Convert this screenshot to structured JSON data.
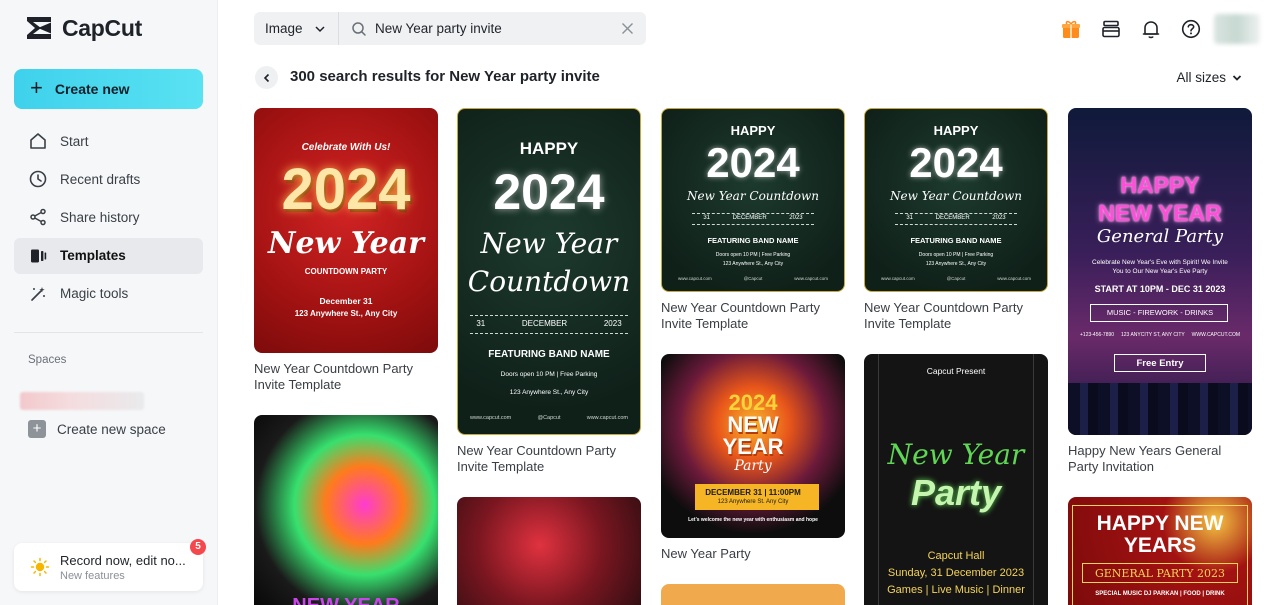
{
  "app": {
    "name": "CapCut",
    "create_label": "Create new",
    "nav": [
      {
        "label": "Start",
        "icon": "home-icon"
      },
      {
        "label": "Recent drafts",
        "icon": "clock-icon"
      },
      {
        "label": "Share history",
        "icon": "share-icon"
      },
      {
        "label": "Templates",
        "icon": "templates-icon",
        "active": true
      },
      {
        "label": "Magic tools",
        "icon": "magic-wand-icon"
      }
    ],
    "spaces_label": "Spaces",
    "create_space_label": "Create new space",
    "record": {
      "title": "Record now, edit no...",
      "subtitle": "New features",
      "badge": "5"
    }
  },
  "search": {
    "type": "Image",
    "query": "New Year party invite"
  },
  "results": {
    "title": "300 search results for New Year party invite",
    "filter": "All sizes"
  },
  "cards": [
    {
      "title": "New Year Countdown Party Invite Template",
      "bg": "#b01717",
      "lines": {
        "l1": "Celebrate With Us!",
        "year": "2024",
        "script": "New Year",
        "sub": "COUNTDOWN PARTY",
        "date": "December 31",
        "addr": "123 Anywhere St., Any City"
      }
    },
    {
      "title": "New Year Countdown Party Invite Template",
      "bg": "#12261f",
      "lines": {
        "happy": "HAPPY",
        "year": "2024",
        "script1": "New Year",
        "script2": "Countdown",
        "d1": "31",
        "d2": "DECEMBER",
        "d3": "2023",
        "band": "FEATURING BAND NAME",
        "doors": "Doors open 10 PM | Free Parking",
        "addr": "123 Anywhere St., Any City",
        "site": "www.capcut.com",
        "brand": "@Capcut"
      }
    },
    {
      "title": "New Year Countdown Party Invite Template",
      "bg": "#12261f",
      "lines": {
        "happy": "HAPPY",
        "year": "2024",
        "script": "New Year Countdown",
        "d1": "31",
        "d2": "DECEMBER",
        "d3": "2023",
        "band": "FEATURING BAND NAME",
        "doors": "Doors open 10 PM | Free Parking",
        "addr": "123 Anywhere St., Any City",
        "site": "www.capcut.com",
        "brand": "@Capcut"
      }
    },
    {
      "title": "New Year Countdown Party Invite Template",
      "bg": "#12261f",
      "lines": {
        "happy": "HAPPY",
        "year": "2024",
        "script": "New Year Countdown",
        "d1": "31",
        "d2": "DECEMBER",
        "d3": "2023",
        "band": "FEATURING BAND NAME",
        "doors": "Doors open 10 PM | Free Parking",
        "addr": "123 Anywhere St., Any City",
        "site": "www.capcut.com",
        "brand": "@Capcut"
      }
    },
    {
      "title": "Happy New Years General Party Invitation",
      "bg": "#1b1640",
      "lines": {
        "happy": "HAPPY",
        "newyear": "NEW YEAR",
        "script": "General Party",
        "invite": "Celebrate New Year's Eve with Spirit! We Invite You to Our New Year's Eve Party",
        "start": "START AT 10PM - DEC 31 2023",
        "acts": "MUSIC  -  FIREWORK  -  DRINKS",
        "entry": "Free Entry",
        "phone": "+123-456-7890",
        "addr": "123 ANYCITY ST, ANY CITY",
        "site": "WWW.CAPCUT.COM"
      }
    },
    {
      "title": "",
      "bg": "#0d0d0d",
      "lines": {
        "big": "NEW YEAR"
      }
    },
    {
      "title": "",
      "bg": "#2a0d10",
      "lines": {}
    },
    {
      "title": "New Year Party",
      "bg": "#0d0d0d",
      "lines": {
        "year": "2024",
        "newyear": "NEW YEAR",
        "script": "Party",
        "date": "DECEMBER 31 | 11:00PM",
        "addr": "123 Anywhere St. Any City",
        "tag": "Let's welcome the new year with enthusiasm and hope"
      }
    },
    {
      "title": "",
      "bg": "#f1a94e",
      "lines": {}
    },
    {
      "title": "",
      "bg": "#141414",
      "lines": {
        "present": "Capcut Present",
        "script1": "New Year",
        "script2": "Party",
        "hall": "Capcut Hall",
        "date": "Sunday, 31 December 2023",
        "acts": "Games | Live Music | Dinner"
      }
    },
    {
      "title": "",
      "bg": "#7a0a0a",
      "lines": {
        "l1": "HAPPY NEW",
        "l2": "YEARS",
        "band": "GENERAL PARTY 2023",
        "foot": "SPECIAL MUSIC DJ PARKAN | FOOD | DRINK"
      }
    }
  ]
}
